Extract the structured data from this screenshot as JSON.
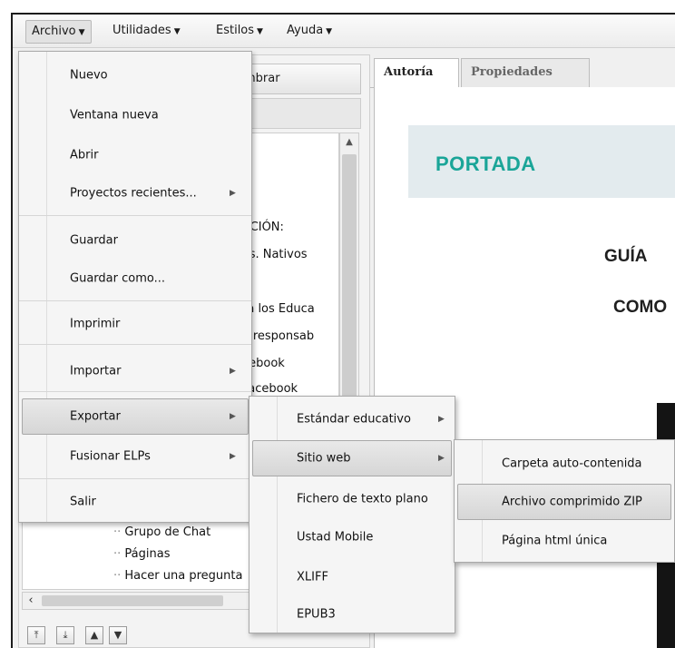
{
  "menubar": {
    "items": [
      {
        "label": "Archivo",
        "mnemonic_index": 3
      },
      {
        "label": "Utilidades",
        "mnemonic_index": 1
      },
      {
        "label": "Estilos",
        "mnemonic_index": 1
      },
      {
        "label": "Ayuda",
        "mnemonic_index": -1
      }
    ]
  },
  "outline": {
    "rename_button_tail": "mbrar",
    "tree_fragments": [
      "ACIÓN:",
      "vs. Nativos",
      "ra los Educa",
      "y responsab",
      "cebook",
      "Facebook"
    ],
    "tree_items": [
      "Grupo de Chat",
      "Páginas",
      "Hacer una pregunta"
    ]
  },
  "tabs": [
    {
      "label": "Autoría",
      "active": true
    },
    {
      "label": "Propiedades",
      "active": false
    }
  ],
  "document": {
    "section_title": "PORTADA",
    "line1": "GUÍA",
    "line2": "COMO",
    "accent_color": "#1aa598"
  },
  "archivo_menu": {
    "items": [
      {
        "label": "Nuevo",
        "submenu": false
      },
      {
        "label": "Ventana nueva",
        "submenu": false
      },
      {
        "label": "Abrir",
        "submenu": false
      },
      {
        "label": "Proyectos recientes...",
        "submenu": true
      },
      {
        "label": "Guardar",
        "submenu": false
      },
      {
        "label": "Guardar como...",
        "submenu": false
      },
      {
        "label": "Imprimir",
        "submenu": false
      },
      {
        "label": "Importar",
        "submenu": true
      },
      {
        "label": "Exportar",
        "submenu": true,
        "highlighted": true
      },
      {
        "label": "Fusionar ELPs",
        "submenu": true
      },
      {
        "label": "Salir",
        "submenu": false
      }
    ]
  },
  "exportar_menu": {
    "items": [
      {
        "label": "Estándar educativo",
        "submenu": true
      },
      {
        "label": "Sitio web",
        "submenu": true,
        "highlighted": true
      },
      {
        "label": "Fichero de texto plano",
        "submenu": false
      },
      {
        "label": "Ustad Mobile",
        "submenu": false
      },
      {
        "label": "XLIFF",
        "submenu": false
      },
      {
        "label": "EPUB3",
        "submenu": false
      }
    ]
  },
  "sitioweb_menu": {
    "items": [
      {
        "label": "Carpeta auto-contenida",
        "submenu": false
      },
      {
        "label": "Archivo comprimido ZIP",
        "submenu": false,
        "highlighted": true
      },
      {
        "label": "Página html única",
        "submenu": false
      }
    ]
  }
}
